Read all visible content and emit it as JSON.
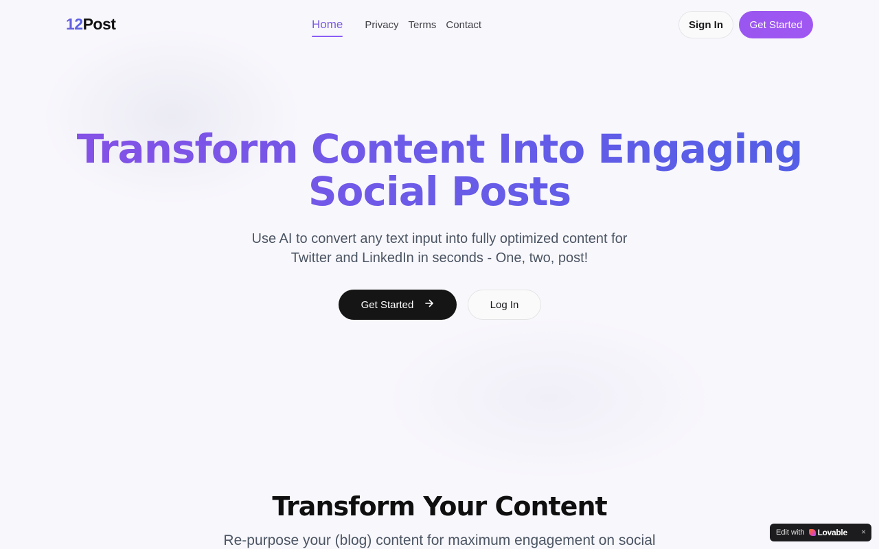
{
  "header": {
    "logo_num": "12",
    "logo_text": "Post",
    "nav": [
      {
        "label": "Home",
        "active": true
      },
      {
        "label": "Privacy",
        "active": false
      },
      {
        "label": "Terms",
        "active": false
      },
      {
        "label": "Contact",
        "active": false
      }
    ],
    "sign_in_label": "Sign In",
    "get_started_label": "Get Started"
  },
  "hero": {
    "title_line1": "Transform Content Into Engaging",
    "title_line2": "Social Posts",
    "subtitle_line1": "Use AI to convert any text input into fully optimized content for",
    "subtitle_line2": "Twitter and LinkedIn in seconds - One, two, post!",
    "primary_label": "Get Started",
    "primary_icon": "arrow-right-icon",
    "secondary_label": "Log In"
  },
  "section": {
    "title": "Transform Your Content",
    "subtitle": "Re-purpose your (blog) content for maximum engagement on social"
  },
  "badge": {
    "prefix": "Edit with",
    "brand": "Lovable",
    "close": "×"
  },
  "colors": {
    "accent": "#8b5cf6",
    "gradient_start": "#8a4fe6",
    "gradient_end": "#4f5fe6",
    "dark_button": "#151515",
    "background": "#f8f7fc"
  }
}
